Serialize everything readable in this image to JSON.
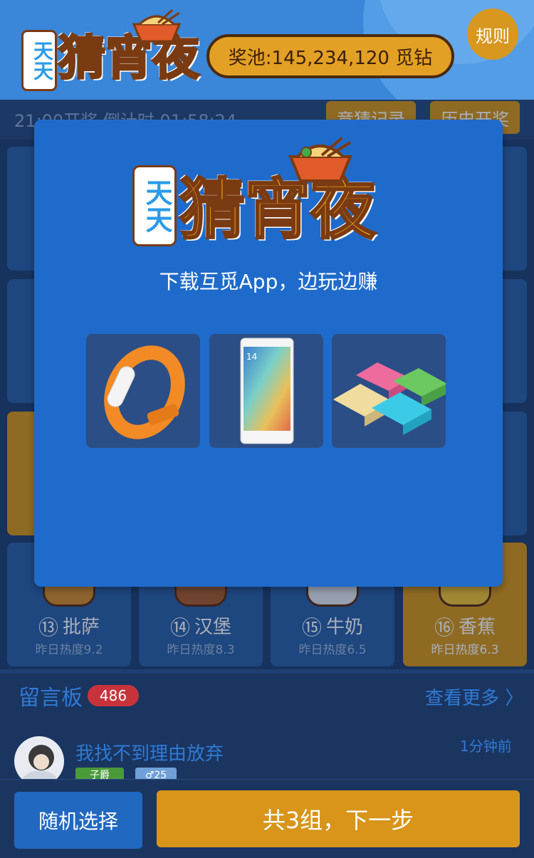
{
  "header": {
    "logo_small": "天天",
    "logo_main": "猜宵夜",
    "pool_label": "奖池:145,234,120 觅钻",
    "rules_label": "规则"
  },
  "timer": {
    "text": "21:00开奖  倒计时 01:58:24",
    "records_label": "竞猜记录",
    "history_label": "历史开奖"
  },
  "grid_bottom_row": [
    {
      "num": "⑬",
      "name": "批萨",
      "heat": "昨日热度9.2",
      "selected": false
    },
    {
      "num": "⑭",
      "name": "汉堡",
      "heat": "昨日热度8.3",
      "selected": false
    },
    {
      "num": "⑮",
      "name": "牛奶",
      "heat": "昨日热度6.5",
      "selected": false
    },
    {
      "num": "⑯",
      "name": "香蕉",
      "heat": "昨日热度6.3",
      "selected": true
    }
  ],
  "modal": {
    "logo_small": "天天",
    "logo_main": "猜宵夜",
    "tagline": "下载互觅App，边玩边赚",
    "phone_time": "14",
    "prizes": [
      "smart-band",
      "smartphone",
      "power-banks"
    ]
  },
  "board": {
    "title": "留言板",
    "count": "486",
    "more_label": "查看更多",
    "username": "我找不到理由放弃",
    "time": "1分钟前",
    "level_tag": "子爵",
    "gender_age": "♂25"
  },
  "bottom": {
    "random_label": "随机选择",
    "next_label": "共3组，下一步"
  },
  "colors": {
    "header_blue": "#3a86d8",
    "modal_blue": "#1f6bcb",
    "accent_orange": "#d8951a",
    "badge_red": "#c8333b"
  }
}
